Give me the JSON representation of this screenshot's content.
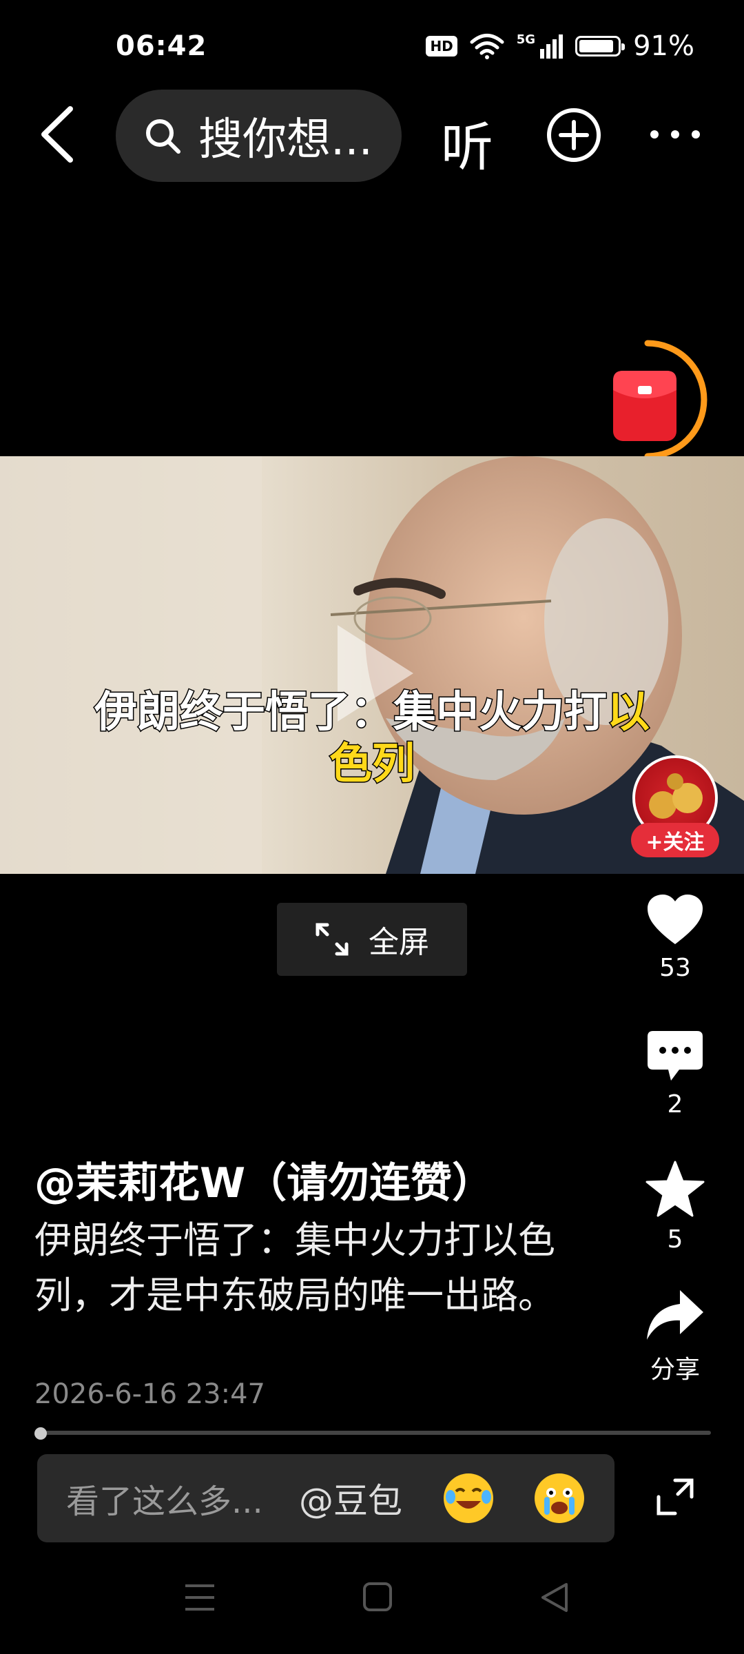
{
  "status": {
    "time": "06:42",
    "hd": "HD",
    "net": "5G",
    "battery": "91%",
    "battery_level": 0.91
  },
  "topbar": {
    "search_text": "搜你想...",
    "listen_label": "听"
  },
  "video": {
    "subtitle_line1_pre": "伊朗终于悟了：集中火力打",
    "subtitle_line1_hl": "以",
    "subtitle_line2_hl": "色列",
    "follow_label": "+关注",
    "fullscreen_label": "全屏"
  },
  "actions": {
    "likes": "53",
    "comments": "2",
    "favorites": "5",
    "share_label": "分享"
  },
  "post": {
    "author": "@茉莉花W（请勿连赞）",
    "description": "伊朗终于悟了：集中火力打以色列，才是中东破局的唯一出路。",
    "timestamp": "2026-6-16 23:47",
    "progress": 0.01
  },
  "comment_bar": {
    "placeholder": "看了这么多...",
    "mention": "@豆包"
  },
  "colors": {
    "accent_red": "#e52e3a",
    "highlight_yellow": "#ffd91a",
    "ring_orange": "#ff9a1a"
  }
}
